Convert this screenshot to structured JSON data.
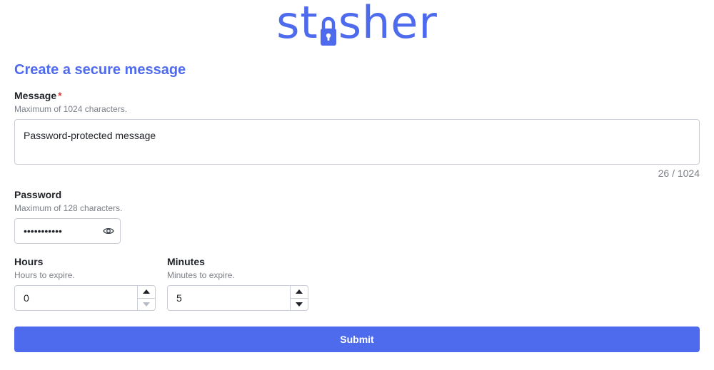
{
  "brand": {
    "logo_prefix": "st",
    "logo_suffix": "sher",
    "color": "#4f6bed"
  },
  "form": {
    "heading": "Create a secure message",
    "message": {
      "label": "Message",
      "required_marker": "*",
      "hint": "Maximum of 1024 characters.",
      "value": "Password-protected message",
      "counter": "26 / 1024"
    },
    "password": {
      "label": "Password",
      "hint": "Maximum of 128 characters.",
      "masked_value": "•••••••••••",
      "toggle_icon": "eye-icon"
    },
    "hours": {
      "label": "Hours",
      "hint": "Hours to expire.",
      "value": "0"
    },
    "minutes": {
      "label": "Minutes",
      "hint": "Minutes to expire.",
      "value": "5"
    },
    "submit_label": "Submit"
  },
  "colors": {
    "accent": "#4f6bed",
    "required": "#d93838",
    "hint": "#7a7f87"
  }
}
